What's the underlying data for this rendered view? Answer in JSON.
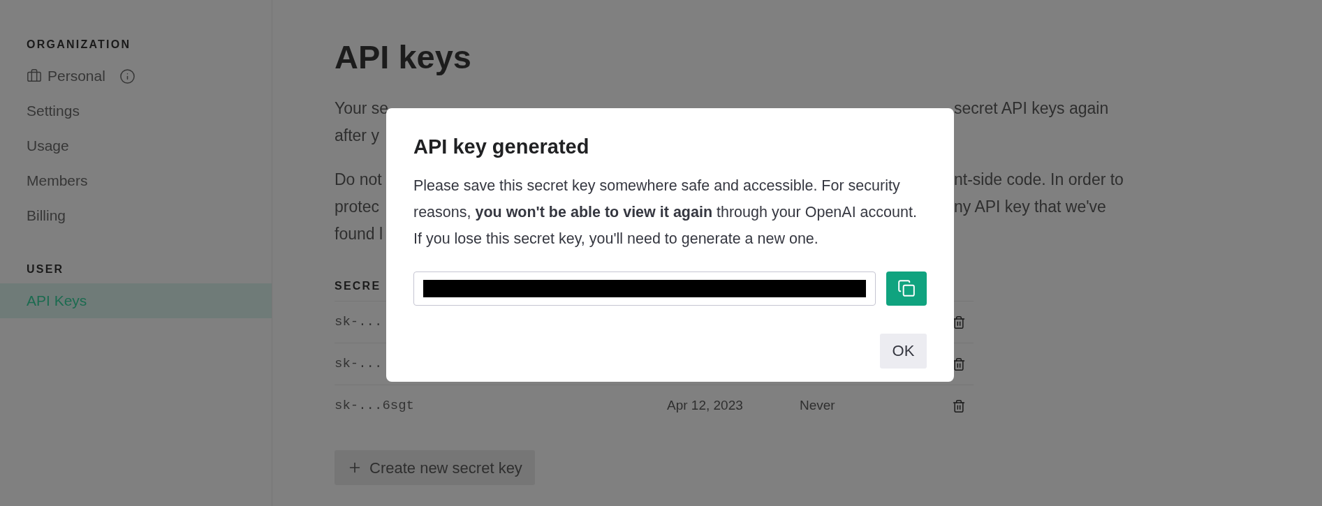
{
  "sidebar": {
    "sections": [
      {
        "heading": "ORGANIZATION",
        "items": [
          {
            "label": "Personal",
            "kind": "org",
            "selected": false
          },
          {
            "label": "Settings",
            "kind": "link",
            "selected": false
          },
          {
            "label": "Usage",
            "kind": "link",
            "selected": false
          },
          {
            "label": "Members",
            "kind": "link",
            "selected": false
          },
          {
            "label": "Billing",
            "kind": "link",
            "selected": false
          }
        ]
      },
      {
        "heading": "USER",
        "items": [
          {
            "label": "API Keys",
            "kind": "link",
            "selected": true
          }
        ]
      }
    ]
  },
  "page": {
    "title": "API keys",
    "paragraphs": [
      {
        "lines": [
          {
            "left": "Your se",
            "right": "secret API keys again"
          },
          {
            "left": "after y"
          }
        ]
      },
      {
        "lines": [
          {
            "left": "Do not",
            "right": "nt-side code. In order to"
          },
          {
            "left": "protec",
            "right": "ny API key that we've"
          },
          {
            "left": "found l"
          }
        ]
      }
    ]
  },
  "table": {
    "column_1": "SECRE",
    "rows": [
      {
        "key": "sk-..."
      },
      {
        "key": "sk-..."
      },
      {
        "key": "sk-...6sgt",
        "created": "Apr 12, 2023",
        "last_used": "Never"
      }
    ]
  },
  "create_button": "Create new secret key",
  "dialog": {
    "title": "API key generated",
    "message": "Please save this secret key somewhere safe and accessible. For security reasons, **you won't be able to view it again** through your OpenAI account. If you lose this secret key, you'll need to generate a new one.",
    "ok_button": "OK"
  }
}
